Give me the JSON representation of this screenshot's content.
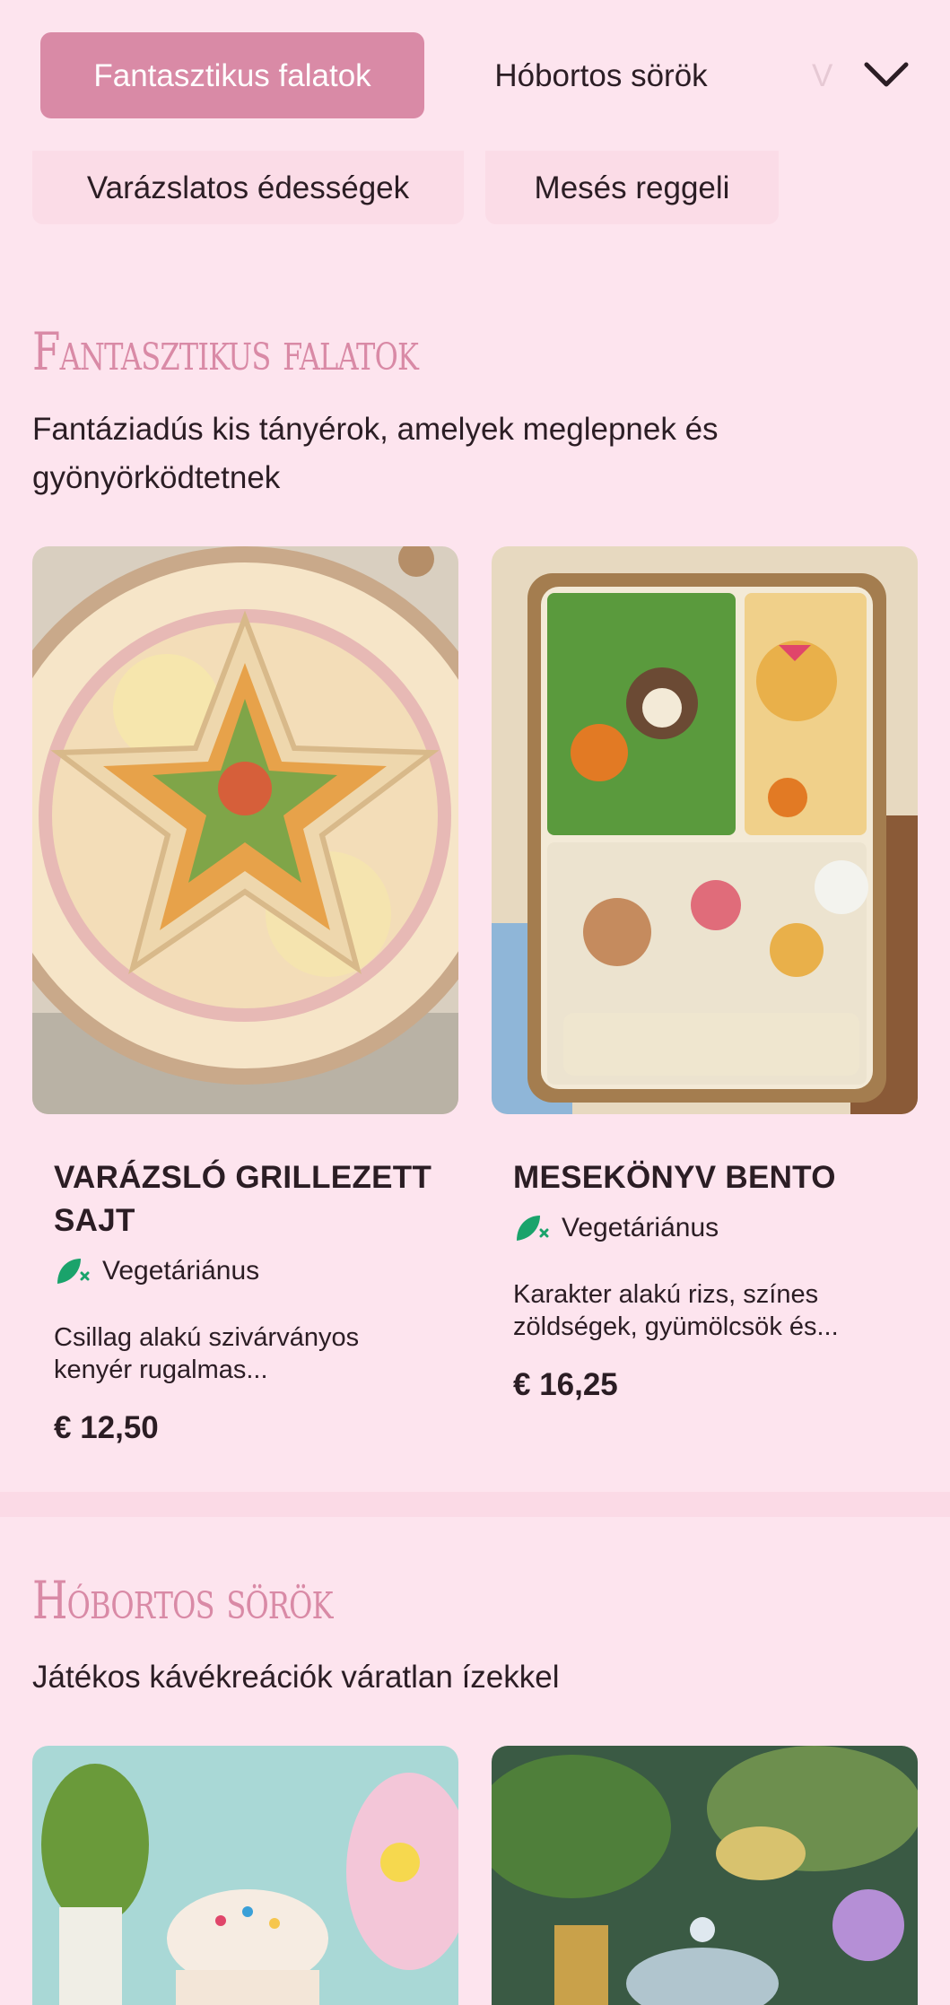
{
  "nav": {
    "tabs": [
      {
        "label": "Fantasztikus falatok",
        "active": true
      },
      {
        "label": "Hóbortos sörök"
      },
      {
        "label": "V"
      }
    ],
    "row2": [
      {
        "label": "Varázslatos édességek"
      },
      {
        "label": "Mesés reggeli"
      }
    ],
    "expand_icon": "chevron-down-icon"
  },
  "sections": [
    {
      "title": "Fantasztikus falatok",
      "subtitle": "Fantáziadús kis tányérok, amelyek meglepnek és gyönyörködtetnek",
      "items": [
        {
          "name": "Varázsló grillezett sajt",
          "tag": "Vegetáriánus",
          "description": "Csillag alakú szivárványos kenyér rugalmas...",
          "price": "€ 12,50"
        },
        {
          "name": "Mesekönyv bento",
          "tag": "Vegetáriánus",
          "description": "Karakter alakú rizs, színes zöldségek, gyümölcsök és...",
          "price": "€ 16,25"
        }
      ]
    },
    {
      "title": "Hóbortos sörök",
      "subtitle": "Játékos kávékreációk váratlan ízekkel"
    }
  ],
  "colors": {
    "accent": "#d98aa6",
    "background": "#fde4ee",
    "veg_icon": "#1aa36b"
  }
}
